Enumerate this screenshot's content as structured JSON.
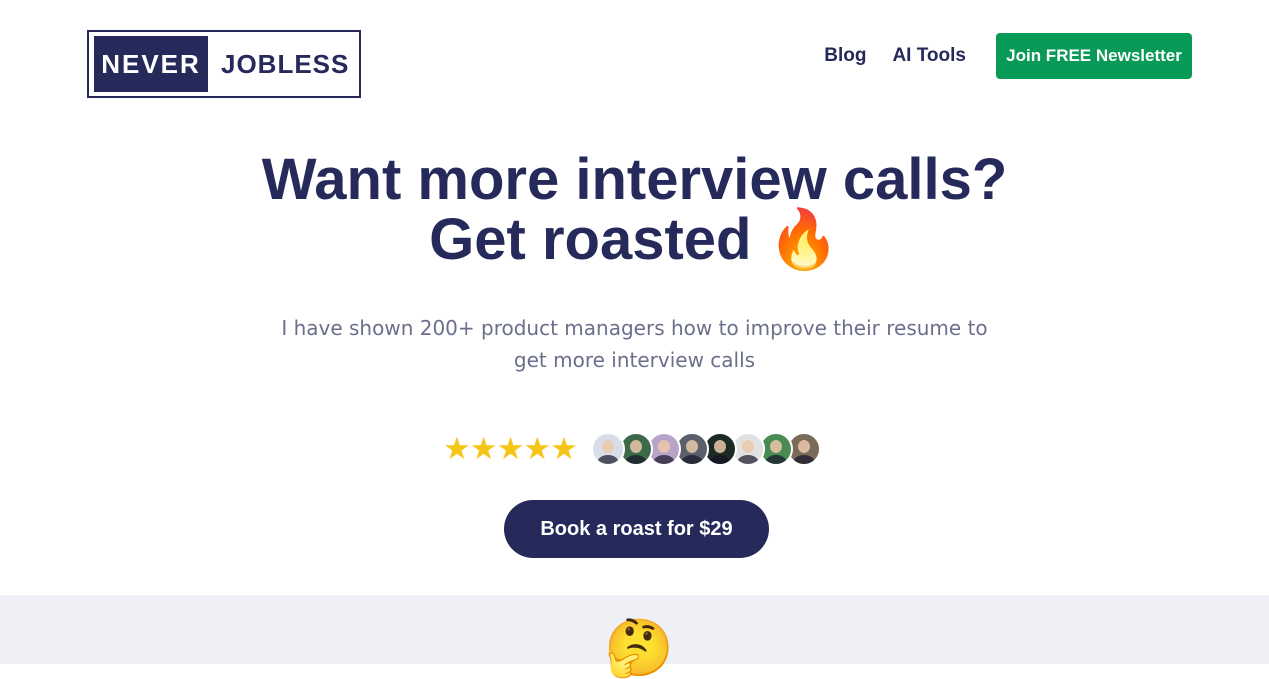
{
  "header": {
    "logo_left": "NEVER",
    "logo_right": "JOBLESS",
    "nav": [
      "Blog",
      "AI Tools"
    ],
    "newsletter_label": "Join FREE Newsletter"
  },
  "hero": {
    "headline_line1": "Want more interview calls?",
    "headline_line2": "Get roasted 🔥",
    "subtext": "I have shown 200+ product managers how to improve their resume to get more interview calls",
    "stars": "★★★★★",
    "rating": 5,
    "avatar_colors": [
      "#d8dde8",
      "#3f6a4a",
      "#b8a4c9",
      "#5a5f6b",
      "#1b2a22",
      "#e2e2e2",
      "#4a8a55",
      "#7a6a5a"
    ],
    "cta_label": "Book a roast for $29"
  },
  "band": {
    "emoji": "🤔"
  },
  "colors": {
    "brand_navy": "#262a5a",
    "newsletter_green": "#0a9a57",
    "star_yellow": "#f5c518",
    "band_bg": "#eff0f6"
  }
}
